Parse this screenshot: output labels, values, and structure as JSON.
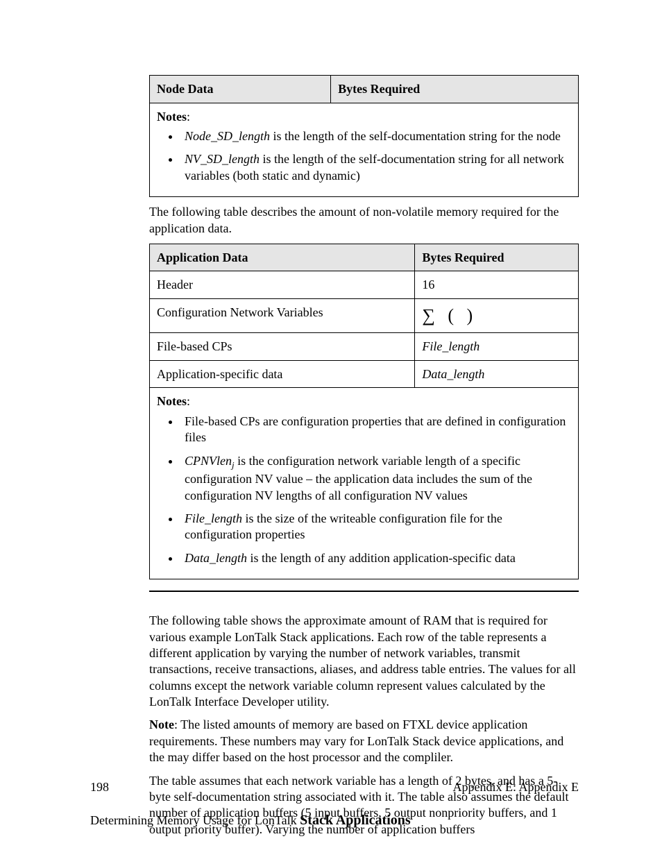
{
  "table1": {
    "head_left": "Node Data",
    "head_right": "Bytes Required",
    "notes_label": "Notes",
    "note1_term": "Node_SD_length",
    "note1_rest": " is the length of the self-documentation string for the node",
    "note2_term": "NV_SD_length",
    "note2_rest": " is the length of the self-documentation string for all network variables (both static and dynamic)"
  },
  "mid_para": "The following table describes the amount of non-volatile memory required for the application data.",
  "table2": {
    "head_left": "Application Data",
    "head_right": "Bytes Required",
    "r1_left": "Header",
    "r1_right": "16",
    "r2_left": "Configuration Network Variables",
    "r2_right": "∑ (            )",
    "r3_left": "File-based CPs",
    "r3_right": "File_length",
    "r4_left": "Application-specific data",
    "r4_right": "Data_length",
    "notes_label": "Notes",
    "n1": "File-based CPs are configuration properties that are defined in configuration files",
    "n2_term": "CPNVlen",
    "n2_sub": "j",
    "n2_rest": " is the configuration network variable length of a specific configuration NV value – the application data includes the sum of the configuration NV lengths of all configuration NV values",
    "n3_term": "File_length",
    "n3_rest": " is the size of the writeable configuration file for the configuration properties",
    "n4_term": "Data_length",
    "n4_rest": " is the length of any addition application-specific data"
  },
  "p1": "The following table shows the approximate amount of RAM that is required for various example LonTalk Stack applications.  Each row of the table represents a different application by varying the number of network variables, transmit transactions, receive transactions, aliases, and address table entries.  The values for all columns except the network variable column represent values calculated by the LonTalk Interface Developer utility.",
  "p2_bold": "Note",
  "p2_rest": ": The listed amounts of memory are based on FTXL device application requirements.  These numbers may vary for LonTalk Stack device applications, and the may differ based on the host processor and the compliler.",
  "p3": "The table assumes that each network variable has a length of 2 bytes, and has a 5-byte self-documentation string associated with it.  The table also assumes the default number of application buffers (5 input buffers, 5 output nonpriority buffers, and 1 output priority buffer).  Varying the number of application buffers",
  "footer_left": "198",
  "footer_right": "Appendix E: Appendix E",
  "bottom_prefix": "Determining Memory Usage for LonTalk ",
  "bottom_big": "Stack Applications"
}
